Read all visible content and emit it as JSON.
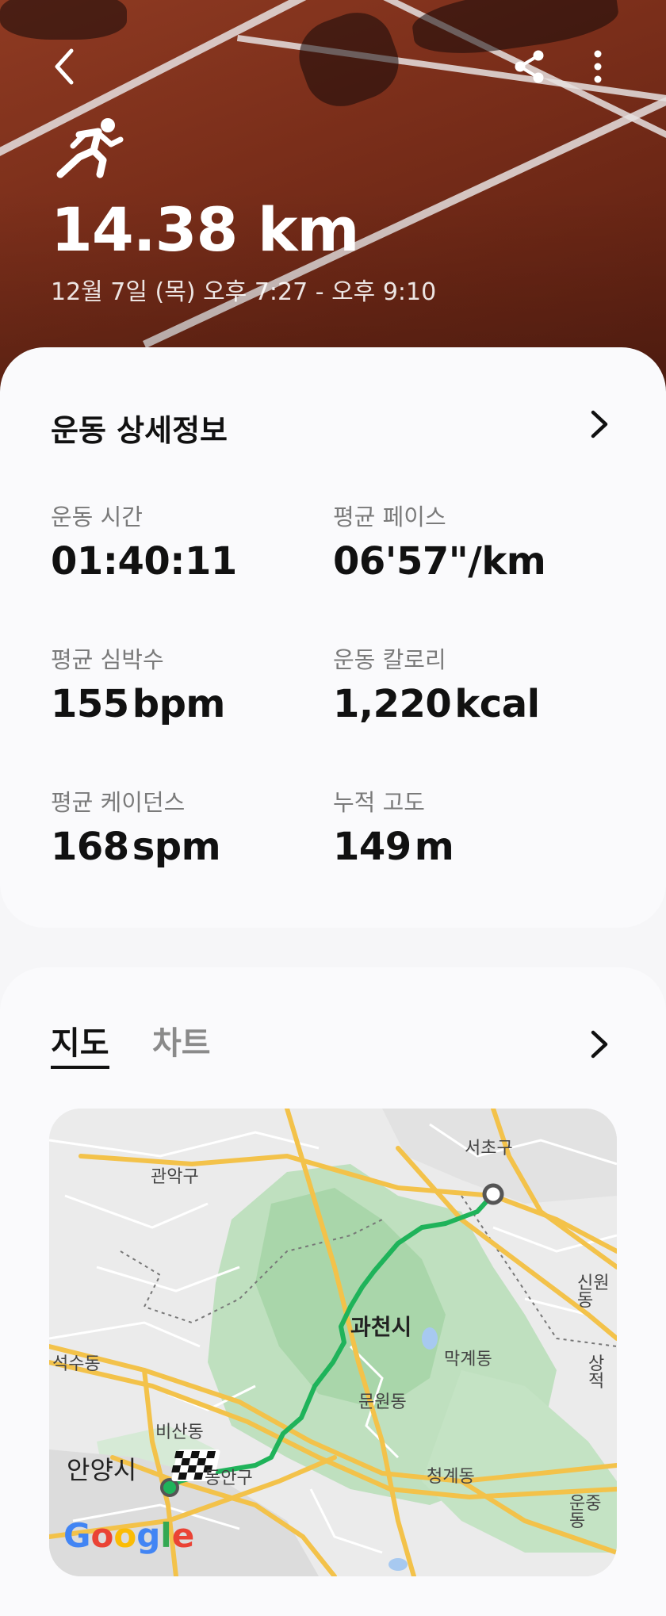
{
  "workout": {
    "distance": "14.38 km",
    "date_range": "12월 7일 (목) 오후 7:27 - 오후 9:10",
    "activity_icon": "running-person-icon"
  },
  "header": {
    "back_icon": "back-arrow-icon",
    "share_icon": "share-icon",
    "more_icon": "more-vertical-icon"
  },
  "details": {
    "title": "운동 상세정보",
    "stats": [
      {
        "label": "운동 시간",
        "value": "01:40:11",
        "unit": ""
      },
      {
        "label": "평균 페이스",
        "value": "06'57\"/km",
        "unit": ""
      },
      {
        "label": "평균 심박수",
        "value": "155",
        "unit": "bpm"
      },
      {
        "label": "운동 칼로리",
        "value": "1,220",
        "unit": "kcal"
      },
      {
        "label": "평균 케이던스",
        "value": "168",
        "unit": "spm"
      },
      {
        "label": "누적 고도",
        "value": "149",
        "unit": "m"
      }
    ]
  },
  "map_section": {
    "tabs": [
      {
        "label": "지도",
        "active": true
      },
      {
        "label": "차트",
        "active": false
      }
    ],
    "map_labels": {
      "seocho": "서초구",
      "gwanak": "관악구",
      "sinwon": "신원동",
      "gwacheon": "과천시",
      "seoksu": "석수동",
      "makgye": "막계동",
      "sangjeok": "상적",
      "munwon": "문원동",
      "bisan": "비산동",
      "anyang": "안양시",
      "dongan": "동안구",
      "cheonggye": "청계동",
      "unjung": "운중동"
    },
    "attribution": "Google",
    "route_color": "#1fb35a"
  }
}
